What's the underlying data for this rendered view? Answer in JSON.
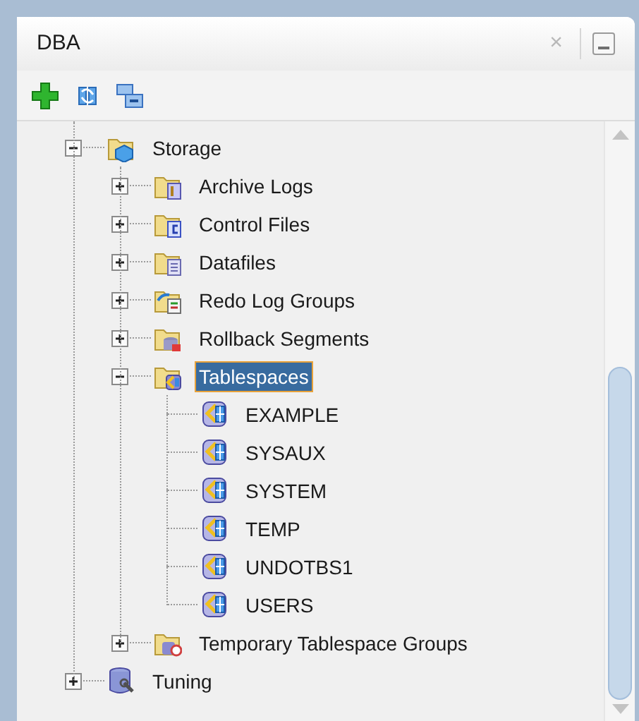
{
  "panel": {
    "title": "DBA",
    "close_label": "×"
  },
  "toolbar": [
    {
      "kind": "add"
    },
    {
      "kind": "refresh"
    },
    {
      "kind": "collapse"
    }
  ],
  "tree": [
    {
      "label": "Storage",
      "kind": "storage",
      "expanded": true,
      "selected": false,
      "children": [
        {
          "label": "Archive Logs",
          "kind": "archive",
          "expanded": false,
          "selected": false
        },
        {
          "label": "Control Files",
          "kind": "control",
          "expanded": false,
          "selected": false
        },
        {
          "label": "Datafiles",
          "kind": "datafile",
          "expanded": false,
          "selected": false
        },
        {
          "label": "Redo Log Groups",
          "kind": "redo",
          "expanded": false,
          "selected": false
        },
        {
          "label": "Rollback Segments",
          "kind": "rollback",
          "expanded": false,
          "selected": false
        },
        {
          "label": "Tablespaces",
          "kind": "tsfolder",
          "expanded": true,
          "selected": true,
          "children": [
            {
              "label": "EXAMPLE",
              "kind": "tablespace",
              "selected": false
            },
            {
              "label": "SYSAUX",
              "kind": "tablespace",
              "selected": false
            },
            {
              "label": "SYSTEM",
              "kind": "tablespace",
              "selected": false
            },
            {
              "label": "TEMP",
              "kind": "tablespace",
              "selected": false
            },
            {
              "label": "UNDOTBS1",
              "kind": "tablespace",
              "selected": false
            },
            {
              "label": "USERS",
              "kind": "tablespace",
              "selected": false
            }
          ]
        },
        {
          "label": "Temporary Tablespace Groups",
          "kind": "tempgroup",
          "expanded": false,
          "selected": false
        }
      ]
    },
    {
      "label": "Tuning",
      "kind": "tuning",
      "expanded": false,
      "selected": false
    }
  ]
}
